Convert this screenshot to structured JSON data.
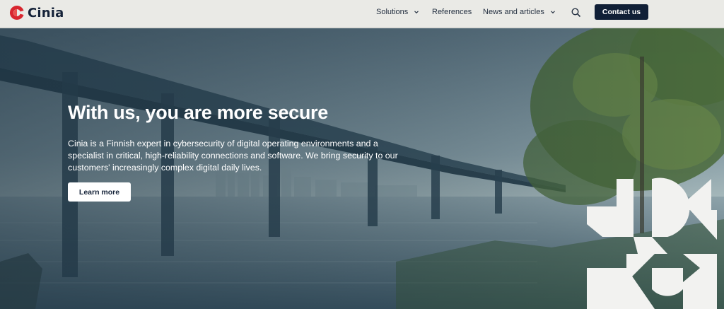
{
  "header": {
    "brand": "Cinia",
    "nav": [
      {
        "label": "Solutions",
        "has_dropdown": true
      },
      {
        "label": "References",
        "has_dropdown": false
      },
      {
        "label": "News and articles",
        "has_dropdown": true
      }
    ],
    "search_icon": "search-icon",
    "contact_label": "Contact us"
  },
  "hero": {
    "title": "With us, you are more secure",
    "description": "Cinia is a Finnish expert in cybersecurity of digital operating environments and a specialist in critical, high-reliability connections and software. We bring security to our customers' increasingly complex digital daily lives.",
    "cta_label": "Learn more"
  },
  "colors": {
    "brand_red": "#d8262f",
    "navy": "#101f36",
    "header_bg": "#eaeae6"
  }
}
